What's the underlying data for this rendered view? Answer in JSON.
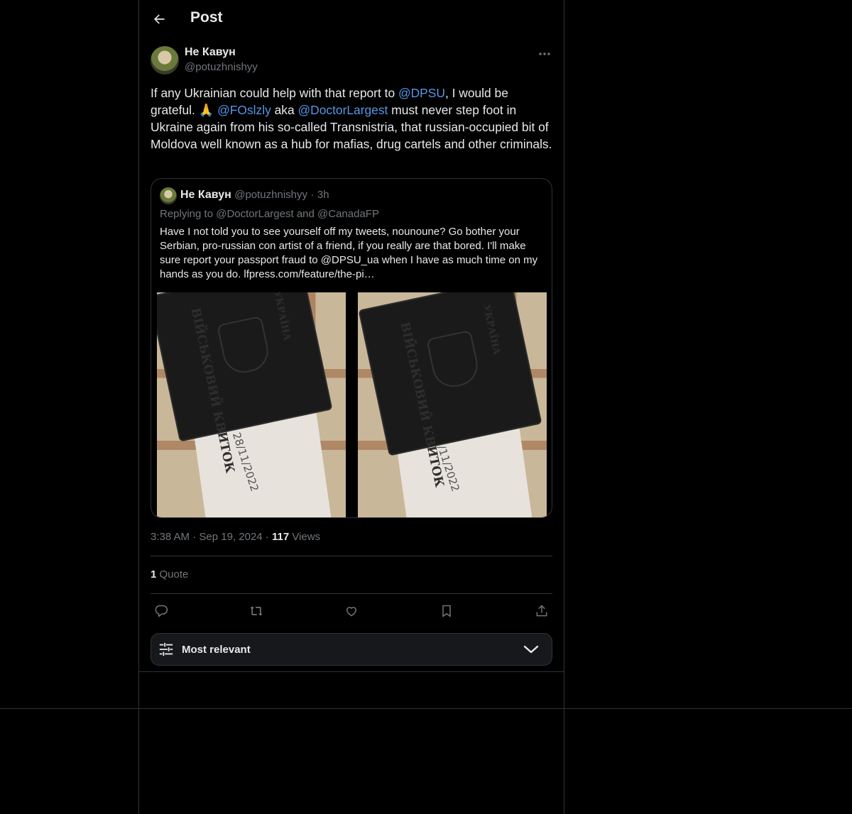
{
  "header": {
    "title": "Post"
  },
  "author": {
    "name": "Не Кавун",
    "handle": "@potuzhnishyy"
  },
  "tweet": {
    "text_1": "If any Ukrainian could help with that report to ",
    "mention_1": "@DPSU",
    "text_2": ", I would be grateful. 🙏 ",
    "mention_2": "@FOslzly",
    "text_3": " aka ",
    "mention_3": "@DoctorLargest",
    "text_4": " must never step foot in Ukraine again from his so-called Transnistria, that russian-occupied bit of Moldova well known as a hub for mafias, drug cartels and other criminals."
  },
  "quote": {
    "name": "Не Кавун",
    "handle": "@potuzhnishyy",
    "dot": "·",
    "time": "3h",
    "replying_to": "Replying to @DoctorLargest and @CanadaFP",
    "text": "Have I not told you to see yourself off my tweets, nounoune? Go bother your Serbian, pro-russian con artist of a friend, if you really are that bored. I'll make sure report your passport fraud to @DPSU_ua when I have as much time on my hands as you do. lfpress.com/feature/the-pi…",
    "images": [
      {
        "description": "military-id-booklet-photo-1",
        "book_title": "ВІЙСЬКОВИЙ КВИТОК",
        "book_org": "УКРАЇНА",
        "paper_text": "28/11/2022"
      },
      {
        "description": "military-id-booklet-photo-2",
        "book_title": "ВІЙСЬКОВИЙ КВИТОК",
        "book_org": "УКРАЇНА",
        "paper_text": "28/11/2022"
      }
    ]
  },
  "meta": {
    "time": "3:38 AM",
    "sep1": " · ",
    "date": "Sep 19, 2024",
    "sep2": " · ",
    "views_count": "117",
    "views_label": " Views"
  },
  "engagement": {
    "quote_count": "1",
    "quote_label": " Quote"
  },
  "actions": {
    "reply_icon": "reply-icon",
    "repost_icon": "repost-icon",
    "like_icon": "like-icon",
    "bookmark_icon": "bookmark-icon",
    "share_icon": "share-icon"
  },
  "sort": {
    "label": "Most relevant"
  },
  "colors": {
    "background": "#000000",
    "text": "#e7e9ea",
    "secondary_text": "#71767b",
    "mention": "#5596e6",
    "border": "#2f3336"
  }
}
